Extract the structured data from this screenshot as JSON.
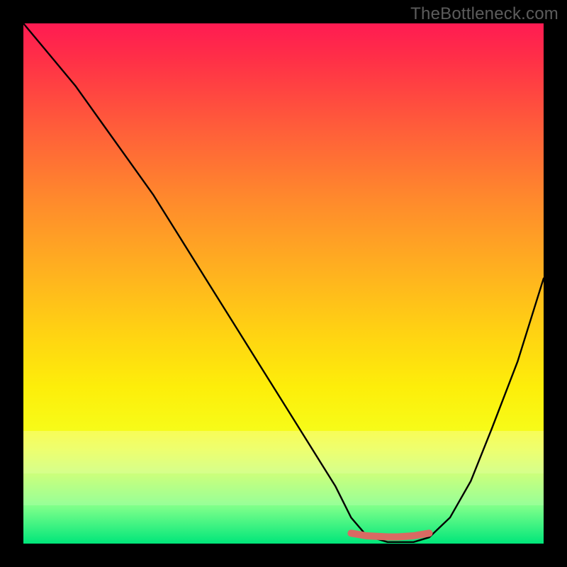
{
  "watermark": "TheBottleneck.com",
  "chart_data": {
    "type": "line",
    "title": "",
    "xlabel": "",
    "ylabel": "",
    "xlim": [
      0,
      100
    ],
    "ylim": [
      0,
      100
    ],
    "series": [
      {
        "name": "curve",
        "x": [
          0,
          5,
          10,
          15,
          20,
          25,
          30,
          35,
          40,
          45,
          50,
          55,
          60,
          63,
          66,
          70,
          72,
          75,
          78,
          82,
          86,
          90,
          95,
          100
        ],
        "values": [
          100,
          94,
          88,
          81,
          74,
          67,
          59,
          51,
          43,
          35,
          27,
          19,
          11,
          5,
          1.5,
          0.3,
          0.3,
          0.3,
          1.2,
          5,
          12,
          22,
          35,
          51
        ]
      },
      {
        "name": "highlight",
        "x": [
          63,
          66,
          70,
          72,
          75,
          78
        ],
        "values": [
          2.0,
          1.5,
          1.3,
          1.3,
          1.5,
          2.0
        ]
      }
    ],
    "colors": {
      "curve": "#000000",
      "highlight": "#d96a63",
      "gradient_top": "#ff1b52",
      "gradient_mid": "#ffd412",
      "gradient_bottom": "#00e67a"
    }
  }
}
